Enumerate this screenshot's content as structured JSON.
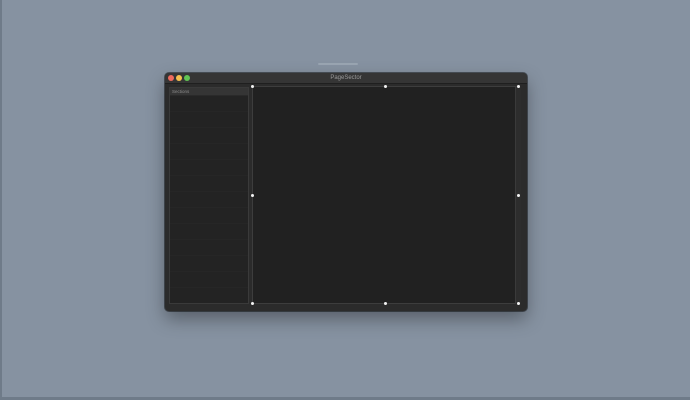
{
  "window": {
    "title": "PageSector"
  },
  "sidebar": {
    "header_label": "Sections",
    "items": []
  },
  "colors": {
    "desktop": "#8692a1",
    "window_bg": "#2b2b2b",
    "titlebar": "#353535",
    "canvas": "#212121",
    "close": "#ee6a5e",
    "minimize": "#f5bf4f",
    "maximize": "#61c454"
  }
}
